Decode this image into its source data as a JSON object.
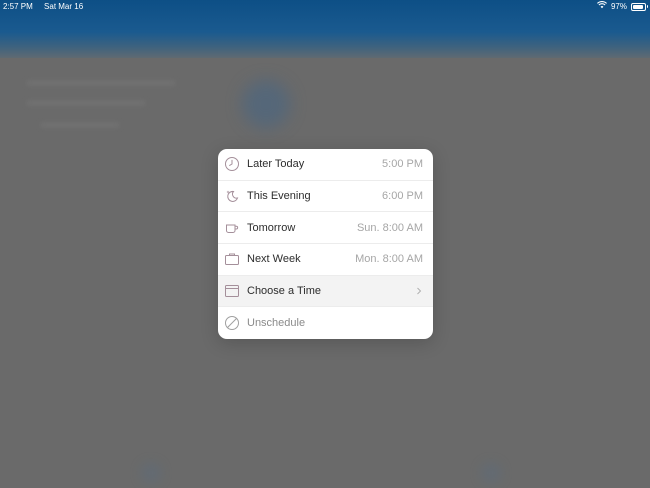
{
  "status_bar": {
    "time": "2:57 PM",
    "date": "Sat Mar 16",
    "battery_percent": "97%"
  },
  "menu": {
    "items": [
      {
        "label": "Later Today",
        "time": "5:00 PM",
        "icon": "clock-icon"
      },
      {
        "label": "This Evening",
        "time": "6:00 PM",
        "icon": "moon-icon"
      },
      {
        "label": "Tomorrow",
        "time": "Sun. 8:00 AM",
        "icon": "coffee-cup-icon"
      },
      {
        "label": "Next Week",
        "time": "Mon. 8:00 AM",
        "icon": "briefcase-icon"
      },
      {
        "label": "Choose a Time",
        "icon": "calendar-icon"
      },
      {
        "label": "Unschedule",
        "icon": "prohibited-icon"
      }
    ]
  },
  "colors": {
    "overlay": "#6a6a6a",
    "header": "#0d4f86",
    "menu_bg": "#ffffff",
    "text_primary": "#2d2d2d",
    "text_secondary": "#a6a6a6",
    "icon_stroke": "#a48f9a"
  }
}
